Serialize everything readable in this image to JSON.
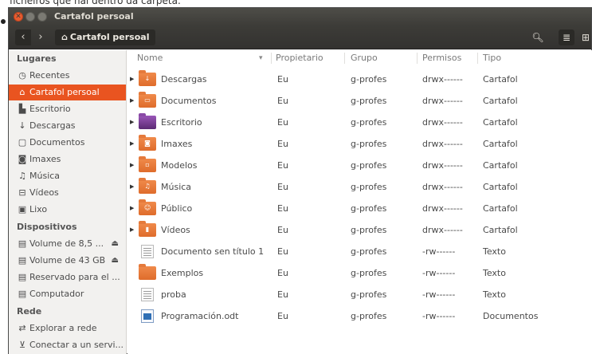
{
  "caption": {
    "text": "ficheiros que hai dentro da carpeta."
  },
  "window": {
    "title": "Cartafol persoal",
    "path_label": "Cartafol persoal"
  },
  "sidebar": {
    "sections": [
      {
        "label": "Lugares",
        "items": [
          {
            "label": "Recentes",
            "icon": "clock-icon",
            "active": false
          },
          {
            "label": "Cartafol persoal",
            "icon": "home-icon",
            "active": true
          },
          {
            "label": "Escritorio",
            "icon": "desktop-icon",
            "active": false
          },
          {
            "label": "Descargas",
            "icon": "download-icon",
            "active": false
          },
          {
            "label": "Documentos",
            "icon": "document-icon",
            "active": false
          },
          {
            "label": "Imaxes",
            "icon": "camera-icon",
            "active": false
          },
          {
            "label": "Música",
            "icon": "music-icon",
            "active": false
          },
          {
            "label": "Vídeos",
            "icon": "film-icon",
            "active": false
          },
          {
            "label": "Lixo",
            "icon": "trash-icon",
            "active": false
          }
        ]
      },
      {
        "label": "Dispositivos",
        "items": [
          {
            "label": "Volume de 8,5 ...",
            "icon": "drive-icon",
            "eject": true
          },
          {
            "label": "Volume de 43 GB",
            "icon": "drive-icon",
            "eject": true
          },
          {
            "label": "Reservado para el ...",
            "icon": "drive-icon",
            "eject": false
          },
          {
            "label": "Computador",
            "icon": "computer-icon",
            "eject": false
          }
        ]
      },
      {
        "label": "Rede",
        "items": [
          {
            "label": "Explorar a rede",
            "icon": "network-icon"
          },
          {
            "label": "Conectar a un servi...",
            "icon": "server-icon"
          }
        ]
      }
    ]
  },
  "columns": [
    "Nome",
    "Propietario",
    "Grupo",
    "Permisos",
    "Tipo"
  ],
  "files": [
    {
      "name": "Descargas",
      "owner": "Eu",
      "group": "g-profes",
      "perms": "drwx------",
      "type": "Cartafol",
      "icon": "folder-download-icon",
      "expandable": true
    },
    {
      "name": "Documentos",
      "owner": "Eu",
      "group": "g-profes",
      "perms": "drwx------",
      "type": "Cartafol",
      "icon": "folder-documents-icon",
      "expandable": true
    },
    {
      "name": "Escritorio",
      "owner": "Eu",
      "group": "g-profes",
      "perms": "drwx------",
      "type": "Cartafol",
      "icon": "folder-desktop-icon",
      "expandable": true
    },
    {
      "name": "Imaxes",
      "owner": "Eu",
      "group": "g-profes",
      "perms": "drwx------",
      "type": "Cartafol",
      "icon": "folder-pictures-icon",
      "expandable": true
    },
    {
      "name": "Modelos",
      "owner": "Eu",
      "group": "g-profes",
      "perms": "drwx------",
      "type": "Cartafol",
      "icon": "folder-templates-icon",
      "expandable": true
    },
    {
      "name": "Música",
      "owner": "Eu",
      "group": "g-profes",
      "perms": "drwx------",
      "type": "Cartafol",
      "icon": "folder-music-icon",
      "expandable": true
    },
    {
      "name": "Público",
      "owner": "Eu",
      "group": "g-profes",
      "perms": "drwx------",
      "type": "Cartafol",
      "icon": "folder-public-icon",
      "expandable": true
    },
    {
      "name": "Vídeos",
      "owner": "Eu",
      "group": "g-profes",
      "perms": "drwx------",
      "type": "Cartafol",
      "icon": "folder-videos-icon",
      "expandable": true
    },
    {
      "name": "Documento sen título 1",
      "owner": "Eu",
      "group": "g-profes",
      "perms": "-rw------",
      "type": "Texto",
      "icon": "text-file-icon",
      "expandable": false
    },
    {
      "name": "Exemplos",
      "owner": "Eu",
      "group": "g-profes",
      "perms": "-rw------",
      "type": "Texto",
      "icon": "folder-link-icon",
      "expandable": false
    },
    {
      "name": "proba",
      "owner": "Eu",
      "group": "g-profes",
      "perms": "-rw------",
      "type": "Texto",
      "icon": "text-file-icon",
      "expandable": false
    },
    {
      "name": "Programación.odt",
      "owner": "Eu",
      "group": "g-profes",
      "perms": "-rw------",
      "type": "Documentos",
      "icon": "odt-document-icon",
      "expandable": false
    }
  ]
}
